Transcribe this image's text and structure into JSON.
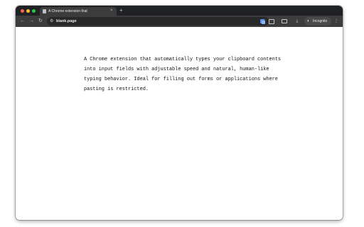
{
  "tab": {
    "title": "A Chrome extension that",
    "close_icon": "×",
    "new_tab_icon": "+"
  },
  "toolbar": {
    "back_icon": "←",
    "forward_icon": "→",
    "reload_icon": "↻",
    "site_info_icon": "⚙",
    "url": "blank.page",
    "star_icon": "☆",
    "download_icon": "⤓",
    "menu_icon": "⋮",
    "incognito_label": "Incognito"
  },
  "content": {
    "lines": [
      "A Chrome extension that automatically types your clipboard contents",
      "into input fields with adjustable speed and natural, human-like",
      "typing behavior. Ideal for filling out forms or applications where",
      "pasting is restricted."
    ]
  },
  "colors": {
    "titlebar": "#202124",
    "toolbar": "#3c3c3c",
    "omnibox": "#282828",
    "page_background": "#ffffff"
  }
}
